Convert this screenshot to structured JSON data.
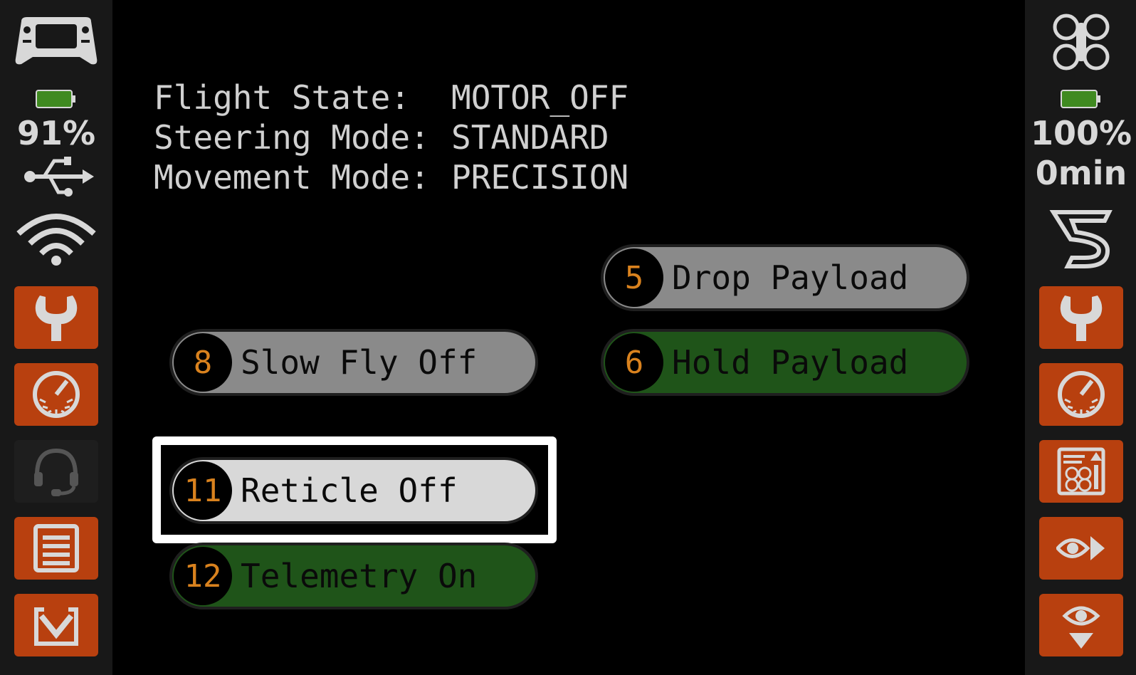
{
  "status": {
    "flight_state_label": "Flight State:",
    "flight_state_value": "MOTOR_OFF",
    "steering_mode_label": "Steering Mode:",
    "steering_mode_value": "STANDARD",
    "movement_mode_label": "Movement Mode:",
    "movement_mode_value": "PRECISION"
  },
  "left_bar": {
    "controller_battery": "91%",
    "icons": [
      "controller-icon",
      "battery-icon",
      "usb-icon",
      "wifi-icon",
      "wrench-icon",
      "gauge-icon",
      "headset-icon",
      "document-icon",
      "download-icon"
    ]
  },
  "right_bar": {
    "drone_battery": "100%",
    "flight_time": "0min",
    "icons": [
      "drone-icon",
      "battery-icon",
      "brand-logo-icon",
      "wrench-icon",
      "gauge-icon",
      "drone-info-icon",
      "eye-forward-icon",
      "eye-down-icon"
    ]
  },
  "buttons": [
    {
      "key": "5",
      "label": "Drop Payload",
      "state": "gray"
    },
    {
      "key": "8",
      "label": "Slow Fly Off",
      "state": "gray"
    },
    {
      "key": "6",
      "label": "Hold Payload",
      "state": "green"
    },
    {
      "key": "11",
      "label": "Reticle Off",
      "state": "selected"
    },
    {
      "key": "12",
      "label": "Telemetry On",
      "state": "green"
    }
  ],
  "colors": {
    "accent_orange": "#b8400f",
    "key_number": "#d9821e",
    "active_green": "#1f5419",
    "inactive_gray": "#8a8a8a",
    "battery_green": "#3f8a20"
  }
}
